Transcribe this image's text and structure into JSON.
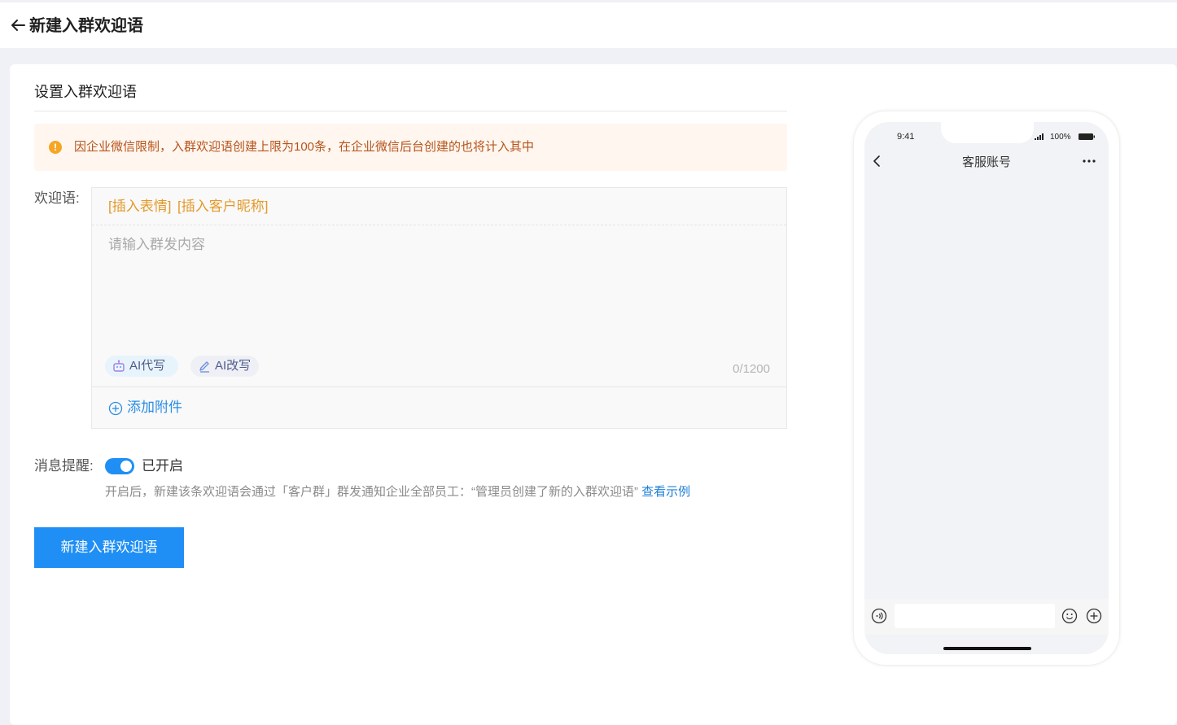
{
  "header": {
    "title": "新建入群欢迎语"
  },
  "form": {
    "section_title": "设置入群欢迎语",
    "notice": "因企业微信限制，入群欢迎语创建上限为100条，在企业微信后台创建的也将计入其中",
    "welcome_label": "欢迎语:",
    "insert_emoji": "[插入表情]",
    "insert_nickname": "[插入客户昵称]",
    "content_placeholder": "请输入群发内容",
    "ai_write": "AI代写",
    "ai_rewrite": "AI改写",
    "char_count": "0/1200",
    "add_attachment": "添加附件",
    "reminder_label": "消息提醒:",
    "reminder_enabled": true,
    "reminder_status": "已开启",
    "reminder_desc": "开启后，新建该条欢迎语会通过「客户群」群发通知企业全部员工：“管理员创建了新的入群欢迎语”",
    "example_link": "查看示例",
    "submit_label": "新建入群欢迎语"
  },
  "phone_preview": {
    "time": "9:41",
    "battery": "100%",
    "chat_title": "客服账号"
  },
  "colors": {
    "primary": "#1f8ff5",
    "warning": "#f5a623",
    "notice_text": "#b6541a",
    "insert_link": "#e39a2b"
  }
}
